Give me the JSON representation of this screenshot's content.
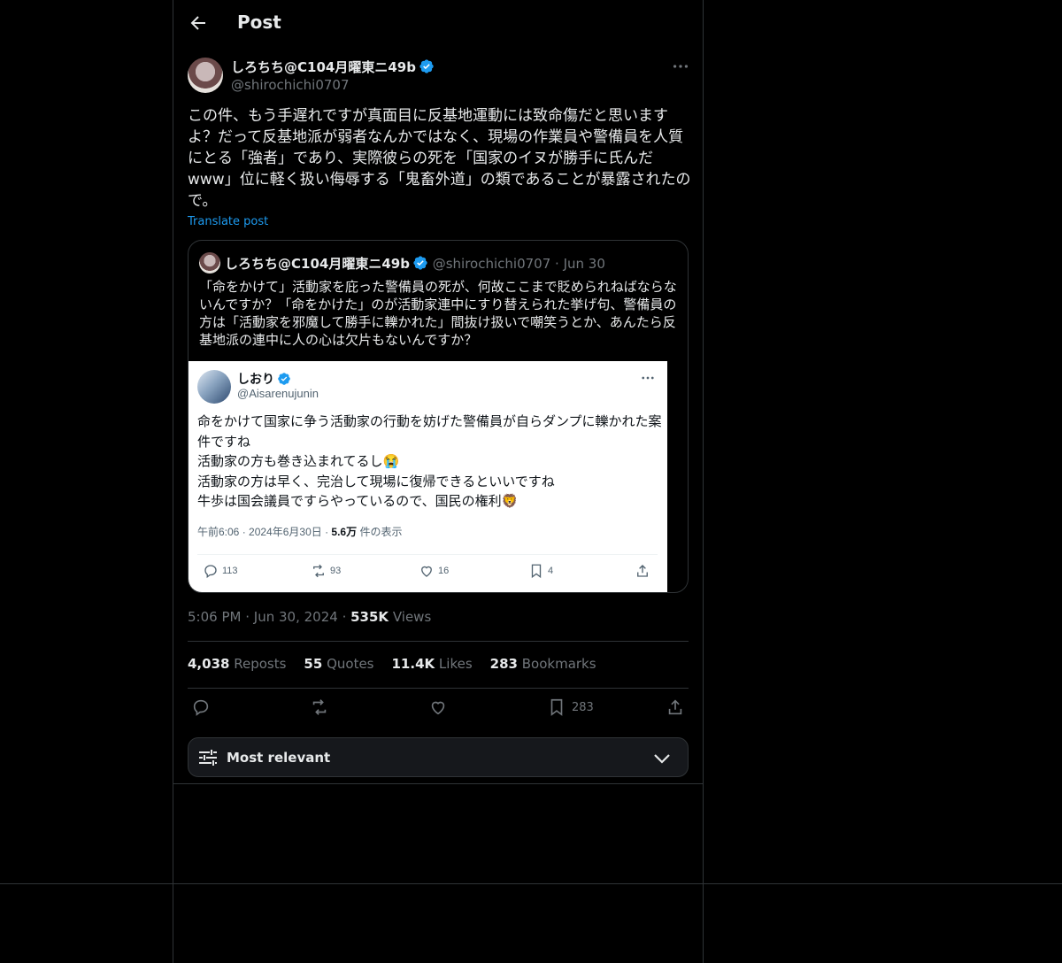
{
  "header": {
    "title": "Post"
  },
  "post": {
    "author_name": "しろちち@C104月曜東ニ49b",
    "author_handle": "@shirochichi0707",
    "text": "この件、もう手遅れですが真面目に反基地運動には致命傷だと思いますよ？だって反基地派が弱者なんかではなく、現場の作業員や警備員を人質にとる「強者」であり、実際彼らの死を「国家のイヌが勝手に氏んだwww」位に軽く扱い侮辱する「鬼畜外道」の類であることが暴露されたので。",
    "translate_label": "Translate post",
    "time": "5:06 PM",
    "date": "Jun 30, 2024",
    "views_count": "535K",
    "views_label": "Views",
    "stats": [
      {
        "count": "4,038",
        "label": "Reposts"
      },
      {
        "count": "55",
        "label": "Quotes"
      },
      {
        "count": "11.4K",
        "label": "Likes"
      },
      {
        "count": "283",
        "label": "Bookmarks"
      }
    ],
    "bookmark_count": "283"
  },
  "quote": {
    "author_name": "しろちち@C104月曜東ニ49b",
    "author_handle": "@shirochichi0707",
    "date": "Jun 30",
    "text": "「命をかけて」活動家を庇った警備員の死が、何故ここまで貶められねばならないんですか？「命をかけた」のが活動家連中にすり替えられた挙げ句、警備員の方は「活動家を邪魔して勝手に轢かれた」間抜け扱いで嘲笑うとか、あんたら反基地派の連中に人の心は欠片もないんですか？",
    "screenshot": {
      "name": "しおり",
      "handle": "@Aisarenujunin",
      "lines": [
        "命をかけて国家に争う活動家の行動を妨げた警備員が自らダンプに轢かれた案件ですね",
        "活動家の方も巻き込まれてるし😭",
        "活動家の方は早く、完治して現場に復帰できるといいですね",
        "牛歩は国会議員ですらやっているので、国民の権利🦁"
      ],
      "meta_time": "午前6:06 · 2024年6月30日 ·",
      "meta_views": "5.6万",
      "meta_views_label": "件の表示",
      "replies": "113",
      "reposts": "93",
      "likes": "16",
      "bookmarks": "4"
    }
  },
  "sort": {
    "label": "Most relevant"
  },
  "colors": {
    "accent": "#1d9bf0",
    "background": "#000000",
    "border": "#2f3336",
    "muted": "#71767b"
  },
  "icons": [
    "back-arrow-icon",
    "verified-badge-icon",
    "more-icon",
    "reply-icon",
    "repost-icon",
    "like-icon",
    "bookmark-icon",
    "share-icon",
    "filter-icon",
    "chevron-down-icon"
  ]
}
